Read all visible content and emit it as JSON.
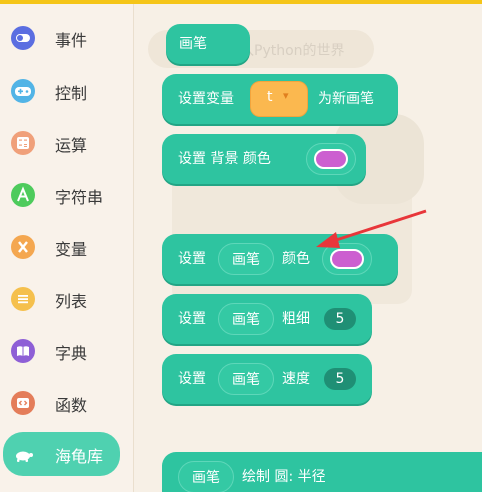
{
  "sidebar": {
    "items": [
      {
        "label": "事件",
        "icon": "toggle-icon",
        "color": "#5b6ee1"
      },
      {
        "label": "控制",
        "icon": "gamepad-icon",
        "color": "#52b4e6"
      },
      {
        "label": "运算",
        "icon": "calculator-icon",
        "color": "#f0a07a"
      },
      {
        "label": "字符串",
        "icon": "letter-a-icon",
        "color": "#4ecb5c"
      },
      {
        "label": "变量",
        "icon": "x-variable-icon",
        "color": "#f4a750"
      },
      {
        "label": "列表",
        "icon": "list-icon",
        "color": "#f5c04d"
      },
      {
        "label": "字典",
        "icon": "book-icon",
        "color": "#8e5fd6"
      },
      {
        "label": "函数",
        "icon": "code-icon",
        "color": "#e47d5a"
      },
      {
        "label": "海龟库",
        "icon": "turtle-icon",
        "color": "#4fd1b0"
      }
    ]
  },
  "canvas": {
    "pen_block": {
      "label": "画笔"
    },
    "set_var_block": {
      "prefix": "设置变量",
      "var_name": "t",
      "suffix": "为新画笔",
      "dropdown_glyph": "▾"
    },
    "bg_color_block": {
      "label": "设置 背景 颜色",
      "color": "#cc5fd0"
    },
    "pen_color_block": {
      "prefix": "设置",
      "target": "画笔",
      "prop": "颜色",
      "color": "#cc5fd0"
    },
    "pen_width_block": {
      "prefix": "设置",
      "target": "画笔",
      "prop": "粗细",
      "value": "5"
    },
    "pen_speed_block": {
      "prefix": "设置",
      "target": "画笔",
      "prop": "速度",
      "value": "5"
    },
    "circle_block": {
      "target": "画笔",
      "label": "绘制 圆: 半径"
    },
    "background_text": {
      "title": "进入Python的世界"
    },
    "annotation_arrow": {
      "color": "#e8363a"
    }
  }
}
